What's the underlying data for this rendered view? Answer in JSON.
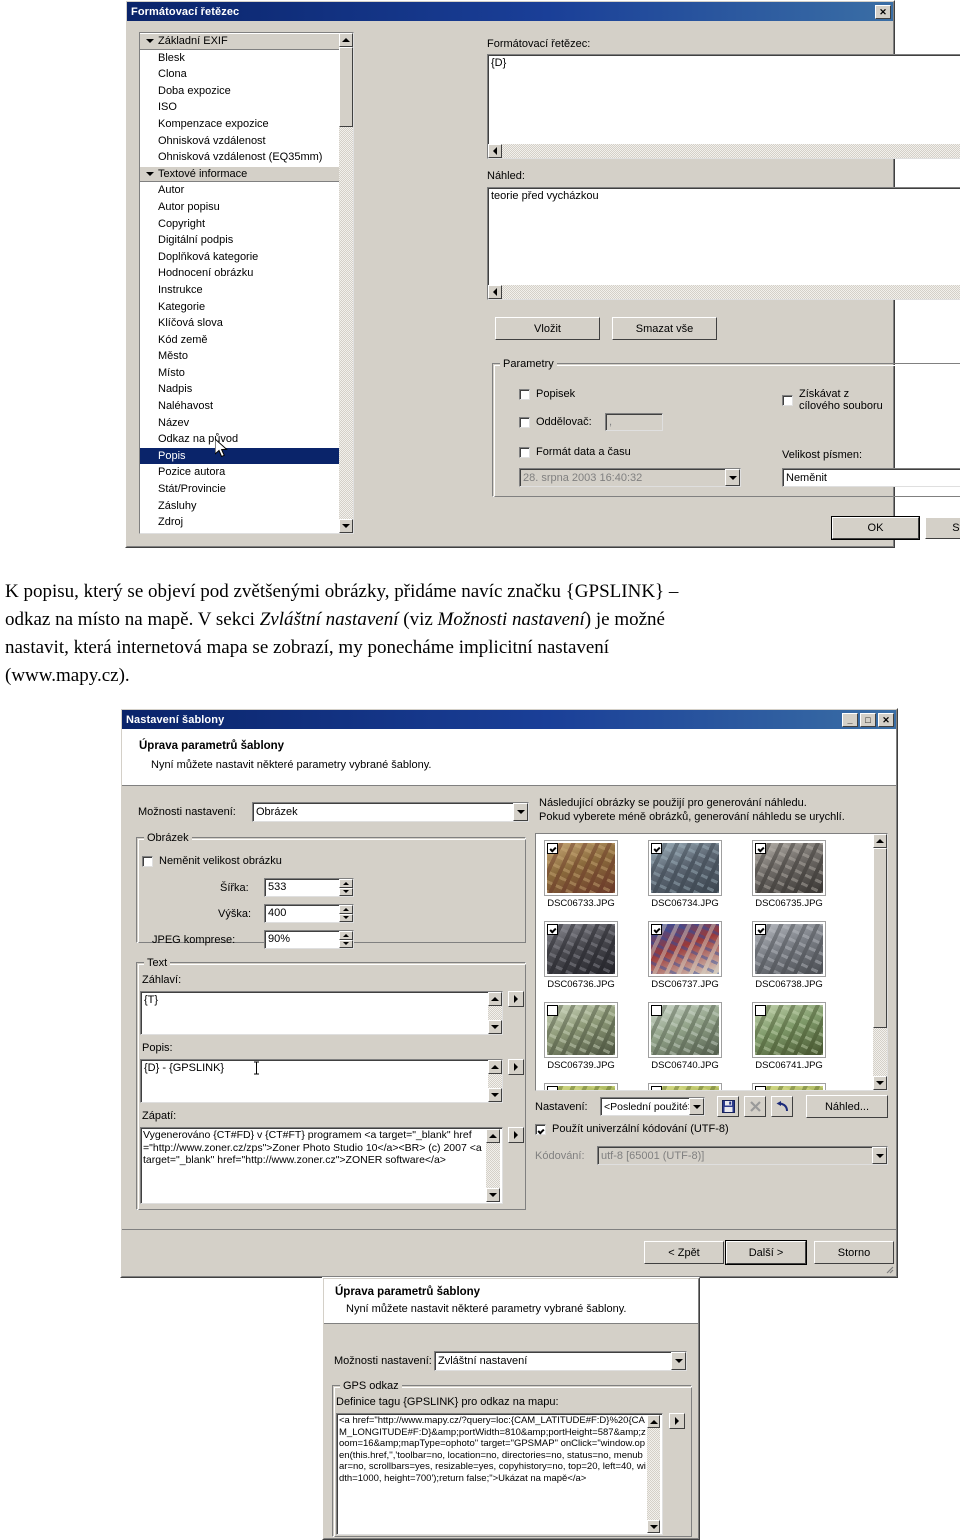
{
  "dialog1": {
    "title": "Formátovací řetězec",
    "close_label": "✕",
    "list": [
      {
        "label": "Základní EXIF",
        "type": "header"
      },
      {
        "label": "Blesk",
        "type": "item"
      },
      {
        "label": "Clona",
        "type": "item"
      },
      {
        "label": "Doba expozice",
        "type": "item"
      },
      {
        "label": "ISO",
        "type": "item"
      },
      {
        "label": "Kompenzace expozice",
        "type": "item"
      },
      {
        "label": "Ohnisková vzdálenost",
        "type": "item"
      },
      {
        "label": "Ohnisková vzdálenost (EQ35mm)",
        "type": "item"
      },
      {
        "label": "Textové informace",
        "type": "header"
      },
      {
        "label": "Autor",
        "type": "item"
      },
      {
        "label": "Autor popisu",
        "type": "item"
      },
      {
        "label": "Copyright",
        "type": "item"
      },
      {
        "label": "Digitální podpis",
        "type": "item"
      },
      {
        "label": "Doplňková kategorie",
        "type": "item"
      },
      {
        "label": "Hodnocení obrázku",
        "type": "item"
      },
      {
        "label": "Instrukce",
        "type": "item"
      },
      {
        "label": "Kategorie",
        "type": "item"
      },
      {
        "label": "Klíčová slova",
        "type": "item"
      },
      {
        "label": "Kód země",
        "type": "item"
      },
      {
        "label": "Město",
        "type": "item"
      },
      {
        "label": "Místo",
        "type": "item"
      },
      {
        "label": "Nadpis",
        "type": "item"
      },
      {
        "label": "Naléhavost",
        "type": "item"
      },
      {
        "label": "Název",
        "type": "item"
      },
      {
        "label": "Odkaz na původ",
        "type": "item"
      },
      {
        "label": "Popis",
        "type": "selected"
      },
      {
        "label": "Pozice autora",
        "type": "item"
      },
      {
        "label": "Stát/Provincie",
        "type": "item"
      },
      {
        "label": "Zásluhy",
        "type": "item"
      },
      {
        "label": "Zdroj",
        "type": "item"
      }
    ],
    "format_label": "Formátovací řetězec:",
    "format_value": "{D}",
    "preview_label": "Náhled:",
    "preview_value": "teorie před vycházkou",
    "insert_button": "Vložit",
    "clear_button": "Smazat vše",
    "params_group": "Parametry",
    "chk_popisek": "Popisek",
    "chk_oddelovac": "Oddělovač:",
    "oddelovac_value": ",",
    "chk_format_data": "Formát data a času",
    "datetime_value": "28. srpna 2003 16:40:32",
    "chk_ziskavat": "Získávat z cílového souboru",
    "velikost_label": "Velikost písmen:",
    "velikost_value": "Neměnit",
    "ok_button": "OK",
    "cancel_button": "Storno"
  },
  "paragraph": {
    "line1": "K popisu, který se objeví pod zvětšenými obrázky, přidáme navíc značku {GPSLINK} –",
    "line2a": "odkaz na místo na mapě. V sekci ",
    "line2i1": "Zvláštní nastavení",
    "line2b": " (viz ",
    "line2i2": "Možnosti nastavení",
    "line2c": ") je možné",
    "line3": "nastavit, která internetová mapa se zobrazí, my ponecháme implicitní nastavení",
    "line4": "(www.mapy.cz)."
  },
  "dialog2": {
    "title": "Nastavení šablony",
    "min_label": "_",
    "max_label": "□",
    "close_label": "✕",
    "head_title": "Úprava parametrů šablony",
    "head_sub": "Nyní můžete nastavit některé parametry vybrané šablony.",
    "options_label": "Možnosti nastavení:",
    "options_value": "Obrázek",
    "hint_line1": "Následující obrázky se použijí pro generování náhledu.",
    "hint_line2": "Pokud vyberete méně obrázků, generování náhledu se urychlí.",
    "img_group": "Obrázek",
    "chk_noresize": "Neměnit velikost obrázku",
    "width_label": "Šířka:",
    "width_value": "533",
    "height_label": "Výška:",
    "height_value": "400",
    "jpeg_label": "JPEG komprese:",
    "jpeg_value": "90%",
    "text_group": "Text",
    "header_label": "Záhlaví:",
    "header_value": "{T}",
    "popis_label": "Popis:",
    "popis_value": "{D} - {GPSLINK}",
    "footer_label": "Zápatí:",
    "footer_value": "Vygenerováno {CT#FD} v {CT#FT} programem <a target=\"_blank\" href=\"http://www.zoner.cz/zps\">Zoner Photo Studio 10</a><BR> (c) 2007 <a target=\"_blank\" href=\"http://www.zoner.cz\">ZONER software</a>",
    "thumbs": [
      {
        "name": "DSC06733.JPG",
        "checked": true,
        "c1": "#8a6a3c",
        "c2": "#c9a978",
        "c3": "#6b3a2a"
      },
      {
        "name": "DSC06734.JPG",
        "checked": true,
        "c1": "#5c6672",
        "c2": "#9fb2bd",
        "c3": "#3c4650"
      },
      {
        "name": "DSC06735.JPG",
        "checked": true,
        "c1": "#6e6a66",
        "c2": "#b7b2ab",
        "c3": "#3a3734"
      },
      {
        "name": "DSC06736.JPG",
        "checked": true,
        "c1": "#4a4a50",
        "c2": "#8e8e96",
        "c3": "#24242a"
      },
      {
        "name": "DSC06737.JPG",
        "checked": true,
        "c1": "#9a3a3a",
        "c2": "#2f4ea0",
        "c3": "#d8d2c4"
      },
      {
        "name": "DSC06738.JPG",
        "checked": true,
        "c1": "#7b7f86",
        "c2": "#b9bcc2",
        "c3": "#4a4d52"
      },
      {
        "name": "DSC06739.JPG",
        "checked": false,
        "c1": "#8e9a78",
        "c2": "#cfd8c0",
        "c3": "#4c5440"
      },
      {
        "name": "DSC06740.JPG",
        "checked": false,
        "c1": "#93a48a",
        "c2": "#cfd9cd",
        "c3": "#55604f"
      },
      {
        "name": "DSC06741.JPG",
        "checked": false,
        "c1": "#7f9a6a",
        "c2": "#c3d3ae",
        "c3": "#46552f"
      },
      {
        "name": "",
        "checked": false,
        "c1": "#9fae55",
        "c2": "#d8dd8a",
        "c3": "#5c6a2a"
      },
      {
        "name": "",
        "checked": false,
        "c1": "#a8b356",
        "c2": "#dbe08c",
        "c3": "#606c2c"
      },
      {
        "name": "",
        "checked": false,
        "c1": "#a3b05a",
        "c2": "#d9df8d",
        "c3": "#5d6a2e"
      }
    ],
    "nastaveni_label": "Nastavení:",
    "nastaveni_value": "<Poslední použité>",
    "save_icon": "save-icon",
    "delete_icon": "delete-icon",
    "undo_icon": "undo-icon",
    "preview_button": "Náhled...",
    "chk_utf8": "Použít univerzální kódování (UTF-8)",
    "encoding_label": "Kódování:",
    "encoding_value": "utf-8   [65001 (UTF-8)]",
    "back_button": "< Zpět",
    "next_button": "Další >",
    "cancel_button": "Storno"
  },
  "dialog3": {
    "head_title": "Úprava parametrů šablony",
    "head_sub": "Nyní můžete nastavit některé parametry vybrané šablony.",
    "options_label": "Možnosti nastavení:",
    "options_value": "Zvláštní nastavení",
    "gps_group": "GPS odkaz",
    "gps_label": "Definice tagu {GPSLINK} pro odkaz na mapu:",
    "gps_value": "<a href=\"http://www.mapy.cz/?query=loc:{CAM_LATITUDE#F:D}%20{CAM_LONGITUDE#F:D}&amp;portWidth=810&amp;portHeight=587&amp;zoom=16&amp;mapType=ophoto\" target=\"GPSMAP\" onClick=\"window.open(this.href,'','toolbar=no, location=no, directories=no, status=no, menubar=no, scrollbars=yes, resizable=yes, copyhistory=no, top=20, left=40, width=1000, height=700');return false;\">Ukázat na mapě</a>"
  }
}
